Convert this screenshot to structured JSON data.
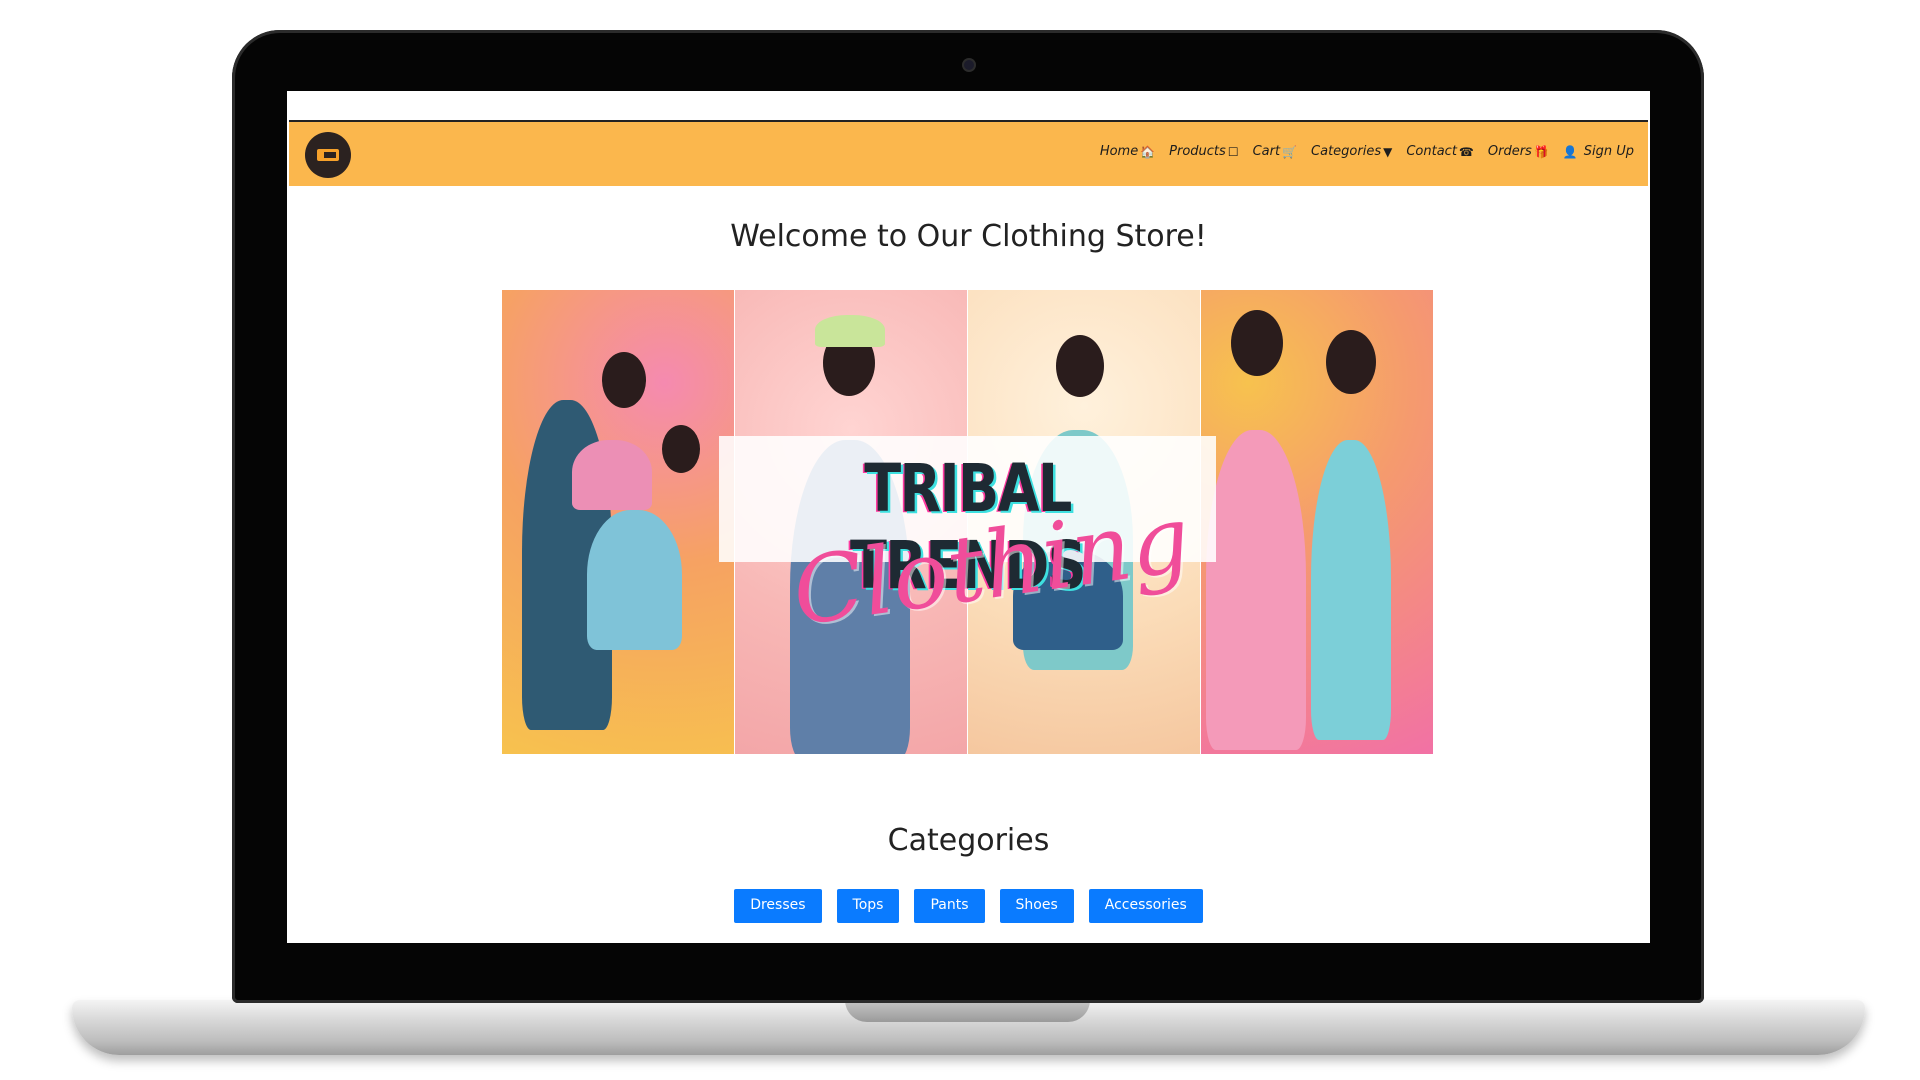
{
  "navbar": {
    "links": [
      {
        "label": "Home",
        "icon": "home-icon",
        "glyph": "🏠"
      },
      {
        "label": "Products",
        "icon": "bag-icon",
        "glyph": "☐"
      },
      {
        "label": "Cart",
        "icon": "cart-icon",
        "glyph": "🛒"
      },
      {
        "label": "Categories",
        "icon": "caret-down-icon",
        "glyph": "▼"
      },
      {
        "label": "Contact",
        "icon": "phone-icon",
        "glyph": "☎"
      },
      {
        "label": "Orders",
        "icon": "gift-icon",
        "glyph": "🎁"
      },
      {
        "label": "Sign Up",
        "icon": "user-icon",
        "glyph": "👤"
      }
    ]
  },
  "main": {
    "welcome": "Welcome to Our Clothing Store!",
    "hero": {
      "title": "TRIBAL TRENDS",
      "script": "Clothing"
    },
    "categories_title": "Categories",
    "categories": [
      "Dresses",
      "Tops",
      "Pants",
      "Shoes",
      "Accessories"
    ]
  },
  "colors": {
    "navbar": "#fbb74d",
    "category_button": "#0a7bff",
    "script_accent": "#f04d9a"
  }
}
